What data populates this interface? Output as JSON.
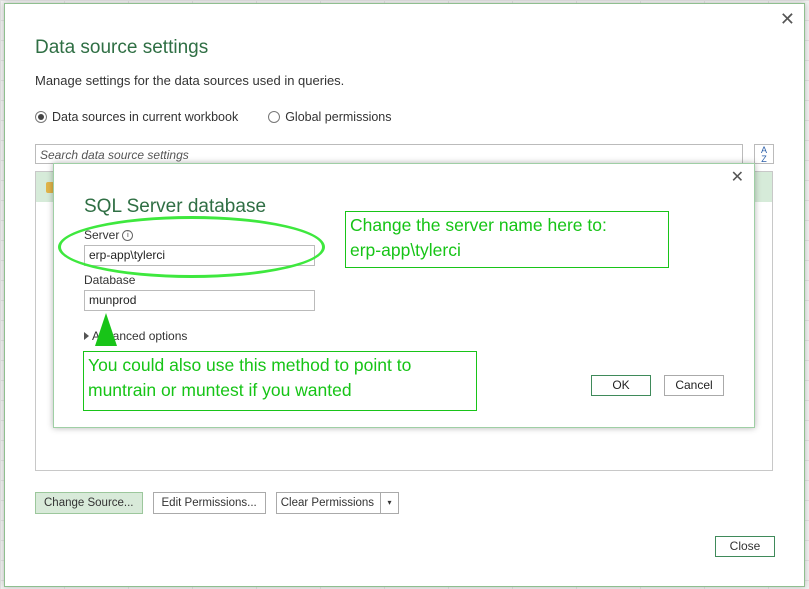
{
  "outer_dialog": {
    "title": "Data source settings",
    "subtitle": "Manage settings for the data sources used in queries.",
    "close_glyph": "✕",
    "radio_current": "Data sources in current workbook",
    "radio_global": "Global permissions",
    "search_placeholder": "Search data source settings",
    "sort_glyph_top": "A",
    "sort_glyph_bottom": "Z",
    "buttons": {
      "change_source": "Change Source...",
      "edit_permissions": "Edit Permissions...",
      "clear_permissions": "Clear Permissions",
      "clear_arrow": "▾",
      "close": "Close"
    }
  },
  "inner_dialog": {
    "title": "SQL Server database",
    "close_glyph": "✕",
    "server_label": "Server",
    "info_glyph": "i",
    "server_value": "erp-app\\tylerci",
    "database_label": "Database",
    "database_value": "munprod",
    "advanced_label": "Advanced options",
    "ok": "OK",
    "cancel": "Cancel"
  },
  "annotations": {
    "callout_server_line1": "Change the server name here to:",
    "callout_server_line2": "erp-app\\tylerci",
    "callout_db_line1": "You could also use this method to point to",
    "callout_db_line2": "muntrain or muntest if you wanted"
  },
  "colors": {
    "accent_green": "#2f6f44",
    "annotation_green": "#16c416",
    "selection_green": "#d6ebd9"
  }
}
